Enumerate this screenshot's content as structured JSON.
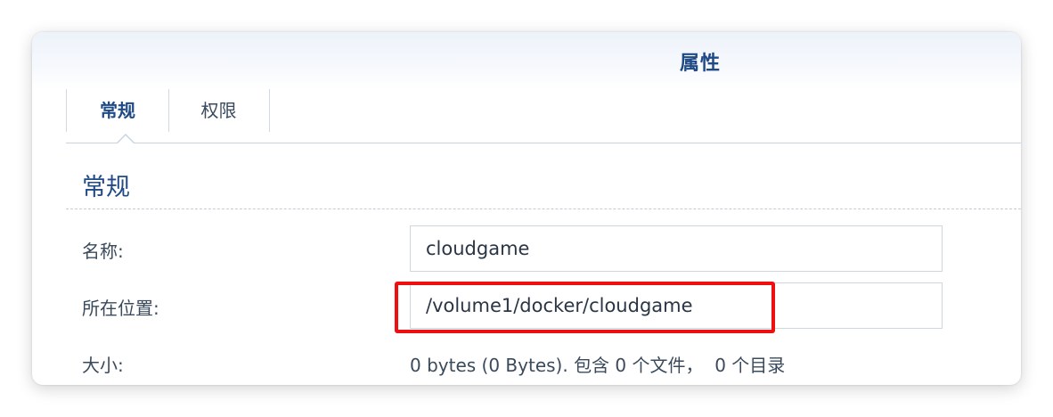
{
  "dialog": {
    "title": "属性"
  },
  "tabs": [
    {
      "label": "常规",
      "active": true
    },
    {
      "label": "权限",
      "active": false
    }
  ],
  "section": {
    "title": "常规"
  },
  "fields": {
    "name": {
      "label": "名称:",
      "value": "cloudgame"
    },
    "location": {
      "label": "所在位置:",
      "value": "/volume1/docker/cloudgame"
    },
    "size": {
      "label": "大小:",
      "value": "0 bytes (0 Bytes). 包含 0 个文件，  0 个目录"
    }
  },
  "colors": {
    "accent": "#1f4a86",
    "highlight": "#ee1010"
  }
}
